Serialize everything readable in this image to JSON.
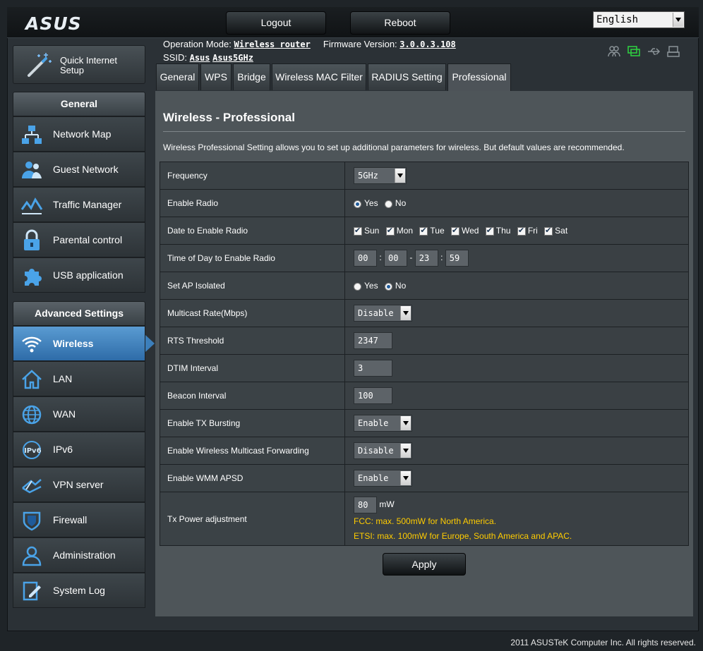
{
  "header": {
    "logo": "ASUS",
    "logout_label": "Logout",
    "reboot_label": "Reboot",
    "language": "English"
  },
  "info": {
    "op_mode_label": "Operation Mode:",
    "op_mode_value": "Wireless router",
    "firmware_label": "Firmware Version:",
    "firmware_value": "3.0.0.3.108",
    "ssid_label": "SSID:",
    "ssid_1": "Asus",
    "ssid_2": "Asus5GHz"
  },
  "sidebar": {
    "quick_setup_line1": "Quick Internet",
    "quick_setup_line2": "Setup",
    "general_heading": "General",
    "general_items": [
      {
        "label": "Network Map",
        "icon": "network-map-icon"
      },
      {
        "label": "Guest Network",
        "icon": "guest-network-icon"
      },
      {
        "label": "Traffic Manager",
        "icon": "traffic-manager-icon"
      },
      {
        "label": "Parental control",
        "icon": "lock-icon"
      },
      {
        "label": "USB application",
        "icon": "puzzle-icon"
      }
    ],
    "advanced_heading": "Advanced Settings",
    "advanced_items": [
      {
        "label": "Wireless",
        "icon": "wifi-icon",
        "active": true
      },
      {
        "label": "LAN",
        "icon": "home-icon"
      },
      {
        "label": "WAN",
        "icon": "globe-icon"
      },
      {
        "label": "IPv6",
        "icon": "ipv6-icon"
      },
      {
        "label": "VPN server",
        "icon": "vpn-icon"
      },
      {
        "label": "Firewall",
        "icon": "shield-icon"
      },
      {
        "label": "Administration",
        "icon": "user-icon"
      },
      {
        "label": "System Log",
        "icon": "log-icon"
      }
    ]
  },
  "tabs": [
    {
      "label": "General"
    },
    {
      "label": "WPS"
    },
    {
      "label": "Bridge"
    },
    {
      "label": "Wireless MAC Filter"
    },
    {
      "label": "RADIUS Setting"
    },
    {
      "label": "Professional",
      "active": true
    }
  ],
  "main": {
    "title": "Wireless - Professional",
    "description": "Wireless Professional Setting allows you to set up additional parameters for wireless. But default values are recommended.",
    "rows": {
      "frequency": {
        "label": "Frequency",
        "value": "5GHz"
      },
      "enable_radio": {
        "label": "Enable Radio",
        "yes": "Yes",
        "no": "No",
        "selected": "Yes"
      },
      "date_radio": {
        "label": "Date to Enable Radio",
        "days": [
          "Sun",
          "Mon",
          "Tue",
          "Wed",
          "Thu",
          "Fri",
          "Sat"
        ]
      },
      "time_radio": {
        "label": "Time of Day to Enable Radio",
        "start_h": "00",
        "start_m": "00",
        "end_h": "23",
        "end_m": "59",
        "sep_colon": ":",
        "sep_dash": "-"
      },
      "ap_isolated": {
        "label": "Set AP Isolated",
        "yes": "Yes",
        "no": "No",
        "selected": "No"
      },
      "multicast_rate": {
        "label": "Multicast Rate(Mbps)",
        "value": "Disable"
      },
      "rts": {
        "label": "RTS Threshold",
        "value": "2347"
      },
      "dtim": {
        "label": "DTIM Interval",
        "value": "3"
      },
      "beacon": {
        "label": "Beacon Interval",
        "value": "100"
      },
      "tx_bursting": {
        "label": "Enable TX Bursting",
        "value": "Enable"
      },
      "multicast_fwd": {
        "label": "Enable Wireless Multicast Forwarding",
        "value": "Disable"
      },
      "wmm_apsd": {
        "label": "Enable WMM APSD",
        "value": "Enable"
      },
      "tx_power": {
        "label": "Tx Power adjustment",
        "value": "80",
        "unit": "mW",
        "note1": "FCC: max. 500mW for North America.",
        "note2": "ETSI: max. 100mW for Europe, South America and APAC."
      }
    },
    "apply_label": "Apply"
  },
  "footer": "2011 ASUSTeK Computer Inc. All rights reserved.",
  "colors": {
    "accent": "#3c7fbb",
    "note": "#ffcc00",
    "background": "#2b3136"
  }
}
